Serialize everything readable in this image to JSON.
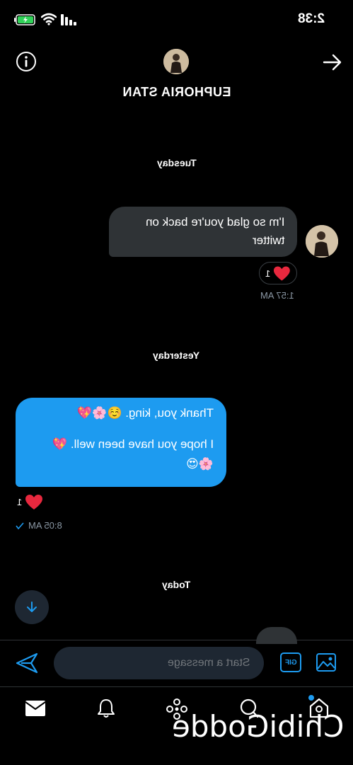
{
  "status_bar": {
    "time": "2:38"
  },
  "header": {
    "title": "EUPHORIA STAN"
  },
  "messages": {
    "day1": "Tuesday",
    "incoming": {
      "line1": "I'm so glad you're back on",
      "line2": "twitter",
      "reaction_count": "1",
      "time": "1:57 AM"
    },
    "day2": "Yesterday",
    "outgoing": {
      "line1": "Thank you, king. ☺️🌸💖",
      "line2": "I hope you have been well. 💖",
      "line3": "🌸😍",
      "reaction_count": "1",
      "time": "8:05 AM"
    },
    "day3": "Today"
  },
  "composer": {
    "placeholder": "Start a message",
    "gif_label": "GIF"
  },
  "watermark": {
    "text": "ChibiGodde"
  },
  "colors": {
    "accent": "#1d9bf0",
    "bubble_incoming": "#2f3336",
    "heart": "#e8283e"
  }
}
